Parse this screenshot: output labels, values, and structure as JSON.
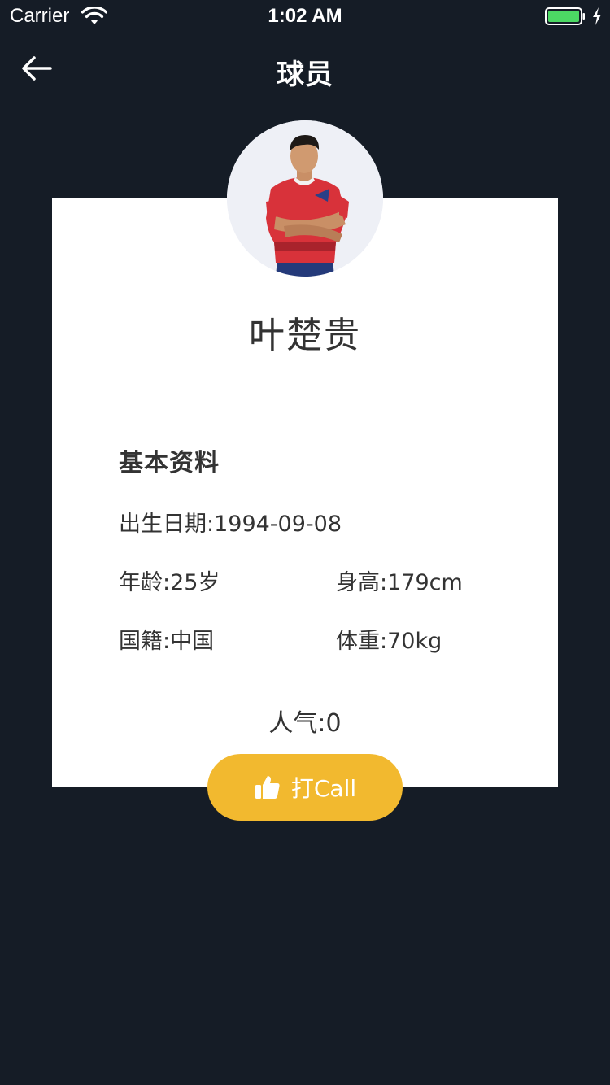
{
  "status_bar": {
    "carrier": "Carrier",
    "time": "1:02 AM",
    "battery_color": "#4cd964"
  },
  "nav": {
    "title": "球员",
    "back_icon": "arrow-left-icon"
  },
  "player": {
    "name": "叶楚贵",
    "photo": "player-portrait"
  },
  "profile": {
    "section_title": "基本资料",
    "birth_date": "出生日期:1994-09-08",
    "age": "年龄:25岁",
    "height": "身高:179cm",
    "nationality": "国籍:中国",
    "weight": "体重:70kg"
  },
  "popularity": {
    "label": "人气:0"
  },
  "call_button": {
    "label": "打Call",
    "icon": "thumbs-up-icon",
    "color": "#f2b92f"
  },
  "colors": {
    "background": "#151c26",
    "card": "#ffffff"
  }
}
